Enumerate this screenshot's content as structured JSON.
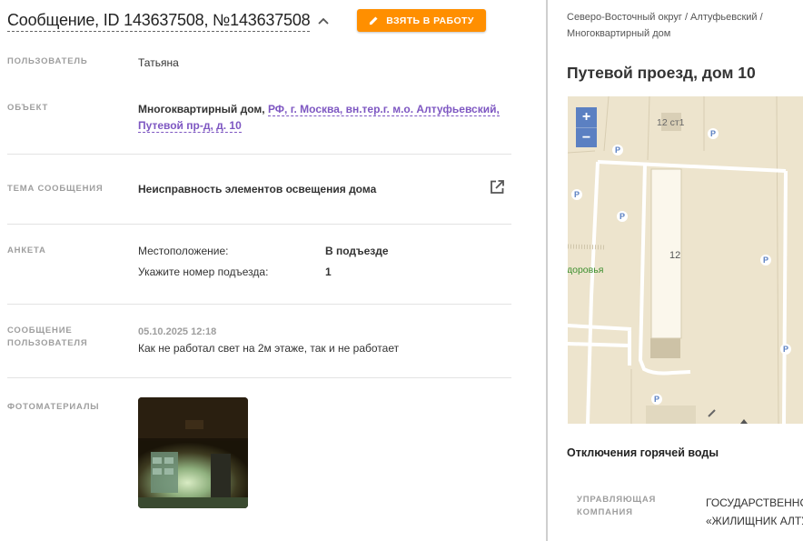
{
  "header": {
    "title": "Сообщение, ID 143637508, №143637508",
    "take_button_label": "ВЗЯТЬ В РАБОТУ"
  },
  "fields": {
    "user": {
      "label": "ПОЛЬЗОВАТЕЛЬ",
      "value": "Татьяна"
    },
    "object": {
      "label": "ОБЪЕКТ",
      "type": "Многоквартирный дом,",
      "address_line1": "РФ, г. Москва, вн.тер.г. м.о. Алтуфьевский,",
      "address_line2": "Путевой пр-д, д. 10"
    },
    "topic": {
      "label": "ТЕМА СООБЩЕНИЯ",
      "value": "Неисправность элементов освещения дома"
    },
    "survey": {
      "label": "АНКЕТА",
      "q1": "Местоположение:",
      "a1": "В подъезде",
      "q2": "Укажите номер подъезда:",
      "a2": "1"
    },
    "message": {
      "label_line1": "СООБЩЕНИЕ",
      "label_line2": "ПОЛЬЗОВАТЕЛЯ",
      "date": "05.10.2025 12:18",
      "text": "Как не работал свет на 2м этаже, так и не работает"
    },
    "photos": {
      "label": "ФОТОМАТЕРИАЛЫ"
    }
  },
  "side": {
    "breadcrumb_line1": "Северо-Восточный округ / Алтуфьевский /",
    "breadcrumb_line2": "Многоквартирный дом",
    "address": "Путевой проезд, дом 10",
    "map": {
      "zoom_in": "+",
      "zoom_out": "−",
      "building_12": "12",
      "building_12s1": "12 ст1",
      "place_label": "доровья",
      "parking": "P"
    },
    "hot_water_title": "Отключения горячей воды",
    "mc_label_line1": "УПРАВЛЯЮЩАЯ",
    "mc_label_line2": "КОМПАНИЯ",
    "mc_value_line1": "ГОСУДАРСТВЕННОЕ",
    "mc_value_line2": "«ЖИЛИЩНИК АЛТУФЬЕВСКИЙ»"
  },
  "colors": {
    "accent": "#ff8f00",
    "link": "#7e57c2",
    "map_bg": "#ede4cd",
    "zoom_btn": "#5b80c2"
  }
}
